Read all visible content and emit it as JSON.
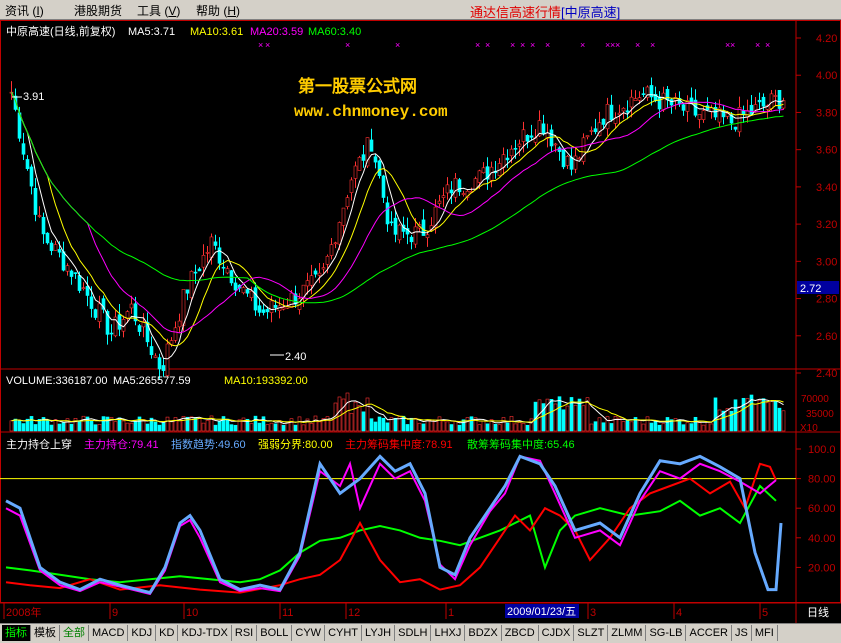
{
  "menu": {
    "items": [
      {
        "label": "资讯 (",
        "hotkey": "I",
        "suffix": ")"
      },
      {
        "label": "港股期货"
      },
      {
        "label": "工具 (",
        "hotkey": "V",
        "suffix": ")"
      },
      {
        "label": "帮助 (",
        "hotkey": "H",
        "suffix": ")"
      }
    ],
    "app_title": "通达信高速行情",
    "app_subtitle": "[中原高速]"
  },
  "price_panel": {
    "title": "中原高速(日线,前复权)",
    "ma5": "MA5:3.71",
    "ma10": "MA10:3.61",
    "ma20": "MA20:3.59",
    "ma60": "MA60:3.40",
    "watermark_line1": "第一股票公式网",
    "watermark_line2": "www.chnmoney.com",
    "high_label": "3.91",
    "low_label": "2.40",
    "current_price_tag": "2.72",
    "y_ticks": [
      "4.20",
      "4.00",
      "3.80",
      "3.60",
      "3.40",
      "3.20",
      "3.00",
      "2.80",
      "2.60",
      "2.40"
    ]
  },
  "volume_panel": {
    "volume": "VOLUME:336187.00",
    "ma5": "MA5:265577.59",
    "ma10": "MA10:193392.00",
    "y_ticks": [
      "70000",
      "35000"
    ],
    "multiplier": "X10"
  },
  "indicator_panel": {
    "name": "主力持仓上穿",
    "l1": "主力持仓:79.41",
    "l2": "指数趋势:49.60",
    "l3": "强弱分界:80.00",
    "l4": "主力筹码集中度:78.91",
    "l5": "散筹筹码集中度:65.46",
    "y_ticks": [
      "100.0",
      "80.00",
      "60.00",
      "40.00",
      "20.00"
    ]
  },
  "x_axis": {
    "labels": [
      "2008年",
      "9",
      "10",
      "11",
      "12",
      "1",
      "2",
      "3",
      "4",
      "5"
    ],
    "cursor_date": "2009/01/23/五",
    "period": "日线"
  },
  "tabs": [
    "指标",
    "模板",
    "全部",
    "MACD",
    "KDJ",
    "KD",
    "KDJ-TDX",
    "RSI",
    "BOLL",
    "CYW",
    "CYHT",
    "LYJH",
    "SDLH",
    "LHXJ",
    "BDZX",
    "ZBCD",
    "CJDX",
    "SLZT",
    "ZLMM",
    "SG-LB",
    "ACCER",
    "JS",
    "MFI"
  ],
  "colors": {
    "up": "#ff3232",
    "down": "#00ffff",
    "ma5": "#ffffff",
    "ma10": "#ffff00",
    "ma20": "#ff00ff",
    "ma60": "#00ff00",
    "axis": "#c00000",
    "main_force": "#ff00ff",
    "index_trend": "#66aaff",
    "chip_main": "#ff0000",
    "chip_retail": "#00ff00",
    "threshold": "#ffff00"
  }
}
